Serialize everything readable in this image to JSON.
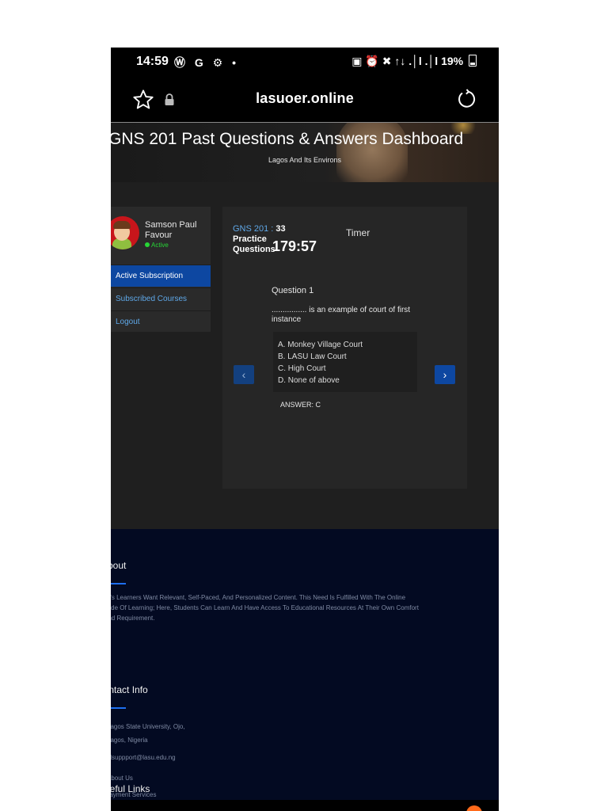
{
  "status_bar": {
    "time": "14:59",
    "app_icons": "Ⓦ G ⚙ •",
    "right": "▣ ⏰ ✖ ↑↓ .│l .│l",
    "battery": "19%"
  },
  "browser": {
    "url": "lasuoer.online"
  },
  "hero": {
    "title": "GNS 201 Past Questions & Answers Dashboard",
    "subtitle": "Lagos And Its Environs"
  },
  "profile": {
    "name": "Samson Paul Favour",
    "status": "Active"
  },
  "menu": [
    {
      "label": "Active Subscription"
    },
    {
      "label": "Subscribed Courses"
    },
    {
      "label": "Logout"
    }
  ],
  "quiz": {
    "course_code": "GNS 201 :",
    "course_count": "33",
    "practice_label": "Practice Questions",
    "timer_label": "Timer",
    "timer_value": "179:57",
    "question_title": "Question 1",
    "question_text": "................ is an example of court of first instance",
    "options": [
      "A. Monkey Village Court",
      "B. LASU Law Court",
      "C. High Court",
      "D. None of above"
    ],
    "answer": "ANSWER: C",
    "prev_symbol": "‹",
    "next_symbol": "›"
  },
  "footer": {
    "about_heading": "About",
    "about_text_1": "Today's Learners Want Relevant, Self-Paced, And Personalized Content. This Need Is Fulfilled With The Online",
    "about_text_2": "Mode Of Learning; Here, Students Can Learn And Have Access To Educational Resources At Their Own Comfort",
    "about_text_3": "And Requirement.",
    "contact_heading": "Contact Info",
    "address_1": "Lagos State University, Ojo,",
    "address_2": "Lagos, Nigeria",
    "email": "Emailsuppport@lasu.edu.ng",
    "links_heading": "Useful Links",
    "link_1": "About Us",
    "link_2": "Payment Services"
  },
  "colors": {
    "accent": "#0d47a1",
    "link": "#5fa8e8",
    "footer_bg": "#030a22",
    "active_green": "#27d636"
  }
}
